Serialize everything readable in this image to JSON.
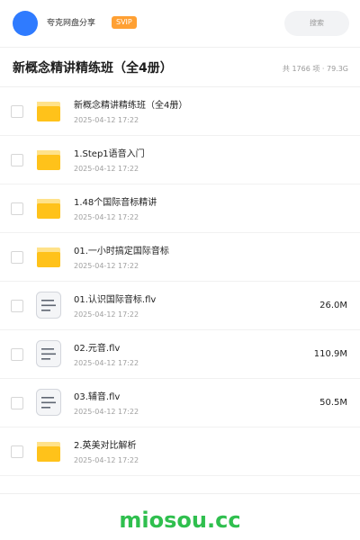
{
  "header": {
    "brand_name": "夸克网盘分享",
    "badge": "SVIP",
    "search_placeholder": "搜索"
  },
  "share": {
    "title": "新概念精讲精练班（全4册）",
    "summary": "共 1766 项 · 79.3G"
  },
  "files": [
    {
      "type": "folder",
      "name": "新概念精讲精练班（全4册）",
      "date": "2025-04-12 17:22",
      "size": ""
    },
    {
      "type": "folder",
      "name": "1.Step1语音入门",
      "date": "2025-04-12 17:22",
      "size": ""
    },
    {
      "type": "folder",
      "name": "1.48个国际音标精讲",
      "date": "2025-04-12 17:22",
      "size": ""
    },
    {
      "type": "folder",
      "name": "01.一小时搞定国际音标",
      "date": "2025-04-12 17:22",
      "size": ""
    },
    {
      "type": "file",
      "name": "01.认识国际音标.flv",
      "date": "2025-04-12 17:22",
      "size": "26.0M"
    },
    {
      "type": "file",
      "name": "02.元音.flv",
      "date": "2025-04-12 17:22",
      "size": "110.9M"
    },
    {
      "type": "file",
      "name": "03.辅音.flv",
      "date": "2025-04-12 17:22",
      "size": "50.5M"
    },
    {
      "type": "folder",
      "name": "2.英美对比解析",
      "date": "2025-04-12 17:22",
      "size": ""
    }
  ],
  "footer": {
    "watermark": "miosou.cc"
  },
  "colors": {
    "accent": "#2f7bff",
    "badge": "#ffa033",
    "folder": "#ffc21a",
    "folder_tab": "#ffe28a",
    "watermark": "#2fbf4e"
  },
  "icons": {
    "folder": "folder-icon",
    "file": "document-icon"
  }
}
